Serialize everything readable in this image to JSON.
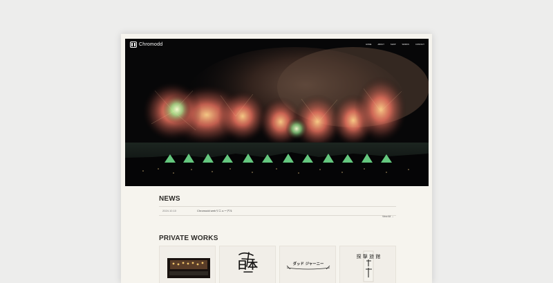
{
  "site": {
    "brand": "Chromodd",
    "nav": [
      "HOME",
      "ABOUT",
      "SHOP",
      "WORKS",
      "CONTACT"
    ]
  },
  "hero": {
    "image_alt": "fireworks over a city at night"
  },
  "news": {
    "title": "NEWS",
    "items": [
      {
        "date": "2024.10.10",
        "text": "Chromodd webリニューアル"
      }
    ],
    "view_all": "View All →"
  },
  "works": {
    "title": "PRIVATE WORKS",
    "items": [
      {
        "label": ""
      },
      {
        "label": "日本"
      },
      {
        "label": "ダッド ジャーニー"
      },
      {
        "label": "探 撃 旅 館"
      }
    ]
  },
  "colors": {
    "background": "#ededec",
    "page": "#f6f4ee",
    "text": "#2d2b28",
    "hero": "#070708"
  }
}
